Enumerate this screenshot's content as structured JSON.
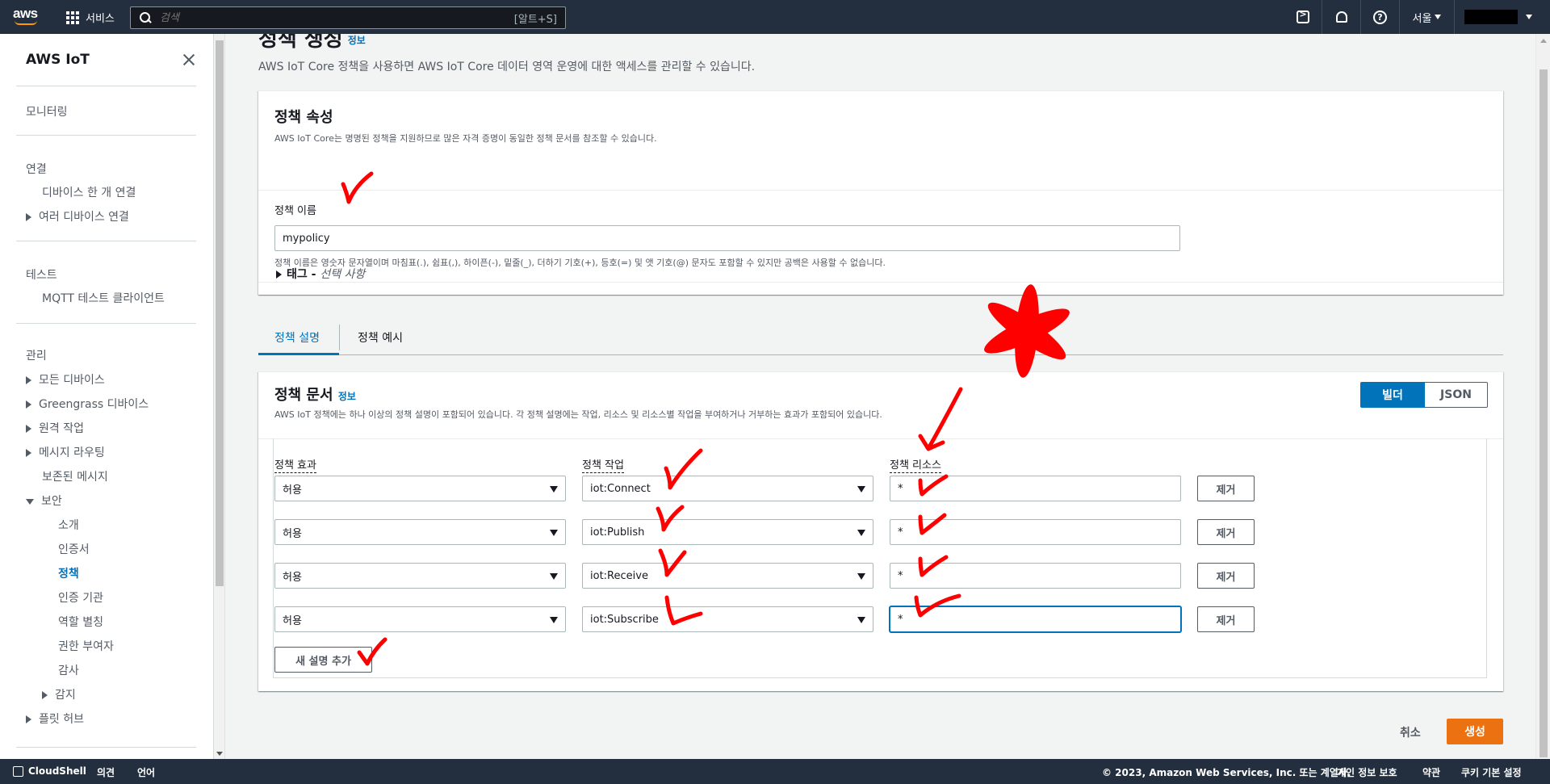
{
  "topnav": {
    "logo_text": "aws",
    "services_label": "서비스",
    "search_placeholder": "검색",
    "search_shortcut": "[알트+S]",
    "region": "서울",
    "brand_color": "#232f3e",
    "accent_color": "#ff9900"
  },
  "sidebar": {
    "title": "AWS IoT",
    "items": [
      {
        "label": "모니터링"
      },
      {
        "label": "연결"
      },
      {
        "label": "디바이스 한 개 연결"
      },
      {
        "label": "여러 디바이스 연결"
      },
      {
        "label": "테스트"
      },
      {
        "label": "MQTT 테스트 클라이언트"
      },
      {
        "label": "관리"
      },
      {
        "label": "모든 디바이스"
      },
      {
        "label": "Greengrass 디바이스"
      },
      {
        "label": "원격 작업"
      },
      {
        "label": "메시지 라우팅"
      },
      {
        "label": "보존된 메시지"
      },
      {
        "label": "보안"
      },
      {
        "label": "소개"
      },
      {
        "label": "인증서"
      },
      {
        "label": "정책"
      },
      {
        "label": "인증 기관"
      },
      {
        "label": "역할 별칭"
      },
      {
        "label": "권한 부여자"
      },
      {
        "label": "감사"
      },
      {
        "label": "감지"
      },
      {
        "label": "플릿 허브"
      }
    ]
  },
  "page": {
    "title": "정책 생성",
    "info": "정보",
    "description": "AWS IoT Core 정책을 사용하면 AWS IoT Core 데이터 영역 운영에 대한 액세스를 관리할 수 있습니다."
  },
  "properties": {
    "title": "정책 속성",
    "description": "AWS IoT Core는 명명된 정책을 지원하므로 많은 자격 증명이 동일한 정책 문서를 참조할 수 있습니다.",
    "name_label": "정책 이름",
    "name_value": "mypolicy",
    "name_hint": "정책 이름은 영숫자 문자열이며 마침표(.), 쉼표(,), 하이픈(-), 밑줄(_), 더하기 기호(+), 등호(=) 및 앳 기호(@) 문자도 포함할 수 있지만 공백은 사용할 수 없습니다.",
    "tags_label": "태그 - ",
    "tags_optional": "선택 사항"
  },
  "tabs": [
    {
      "label": "정책 설명",
      "active": true
    },
    {
      "label": "정책 예시",
      "active": false
    }
  ],
  "document": {
    "title": "정책 문서",
    "info": "정보",
    "description": "AWS IoT 정책에는 하나 이상의 정책 설명이 포함되어 있습니다. 각 정책 설명에는 작업, 리소스 및 리소스별 작업을 부여하거나 거부하는 효과가 포함되어 있습니다.",
    "mode_builder": "빌더",
    "mode_json": "JSON",
    "col_effect": "정책 효과",
    "col_action": "정책 작업",
    "col_resource": "정책 리소스",
    "remove_label": "제거",
    "statements": [
      {
        "effect": "허용",
        "action": "iot:Connect",
        "resource": "*"
      },
      {
        "effect": "허용",
        "action": "iot:Publish",
        "resource": "*"
      },
      {
        "effect": "허용",
        "action": "iot:Receive",
        "resource": "*"
      },
      {
        "effect": "허용",
        "action": "iot:Subscribe",
        "resource": "*"
      }
    ],
    "add_statement": "새 설명 추가"
  },
  "actions": {
    "cancel": "취소",
    "create": "생성",
    "primary_color": "#ec7211"
  },
  "footer": {
    "cloudshell": "CloudShell",
    "feedback": "의견",
    "language": "언어",
    "copyright": "© 2023, Amazon Web Services, Inc. 또는 계열사.",
    "privacy": "개인 정보 보호",
    "terms": "약관",
    "cookies": "쿠키 기본 설정"
  },
  "annotation_color": "#ff0000"
}
